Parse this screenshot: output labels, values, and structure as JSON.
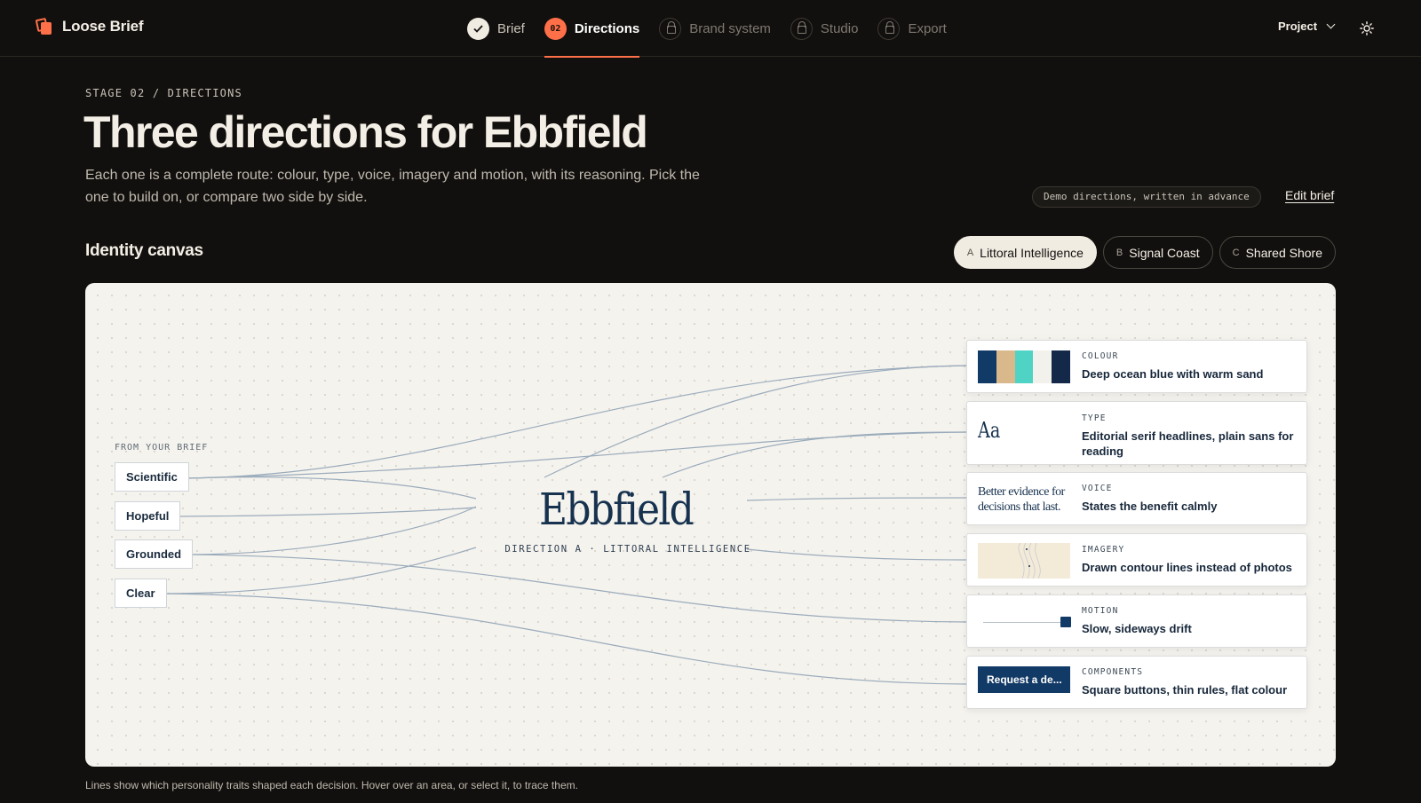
{
  "app": {
    "name": "Loose Brief"
  },
  "nav": {
    "steps": [
      {
        "label": "Brief",
        "state": "done"
      },
      {
        "label": "Directions",
        "number": "02",
        "state": "active"
      },
      {
        "label": "Brand system",
        "state": "locked"
      },
      {
        "label": "Studio",
        "state": "locked"
      },
      {
        "label": "Export",
        "state": "locked"
      }
    ],
    "project_label": "Project"
  },
  "header": {
    "stage": "STAGE 02 / DIRECTIONS",
    "title": "Three directions for Ebbfield",
    "description": "Each one is a complete route: colour, type, voice, imagery and motion, with its reasoning. Pick the one to build on, or compare two side by side.",
    "demo_badge": "Demo directions, written in advance",
    "edit_brief": "Edit brief"
  },
  "canvas": {
    "section_title": "Identity canvas",
    "directions": [
      {
        "key": "A",
        "label": "Littoral Intelligence",
        "selected": true
      },
      {
        "key": "B",
        "label": "Signal Coast",
        "selected": false
      },
      {
        "key": "C",
        "label": "Shared Shore",
        "selected": false
      }
    ],
    "from_label": "FROM YOUR BRIEF",
    "traits": [
      "Scientific",
      "Hopeful",
      "Grounded",
      "Clear"
    ],
    "brand_name": "Ebbfield",
    "brand_subtitle": "DIRECTION A · LITTORAL INTELLIGENCE",
    "decisions": {
      "colour": {
        "caption": "COLOUR",
        "value": "Deep ocean blue with warm sand",
        "swatches": [
          "#123a66",
          "#d9b98b",
          "#4fd3c4",
          "#f3f1ec",
          "#14294a"
        ]
      },
      "type": {
        "caption": "TYPE",
        "value": "Editorial serif headlines, plain sans for reading",
        "sample": "Aa"
      },
      "voice": {
        "caption": "VOICE",
        "value": "States the benefit calmly",
        "sample": "Better evidence for decisions that last."
      },
      "imagery": {
        "caption": "IMAGERY",
        "value": "Drawn contour lines instead of photos"
      },
      "motion": {
        "caption": "MOTION",
        "value": "Slow, sideways drift"
      },
      "components": {
        "caption": "COMPONENTS",
        "value": "Square buttons, thin rules, flat colour",
        "sample_button": "Request a de..."
      }
    },
    "footnote": "Lines show which personality traits shaped each decision. Hover over an area, or select it, to trace them."
  },
  "colors": {
    "accent": "#ff7049",
    "ink": "#17324f",
    "canvas": "#f5f3ee",
    "line": "#9aabbb"
  }
}
